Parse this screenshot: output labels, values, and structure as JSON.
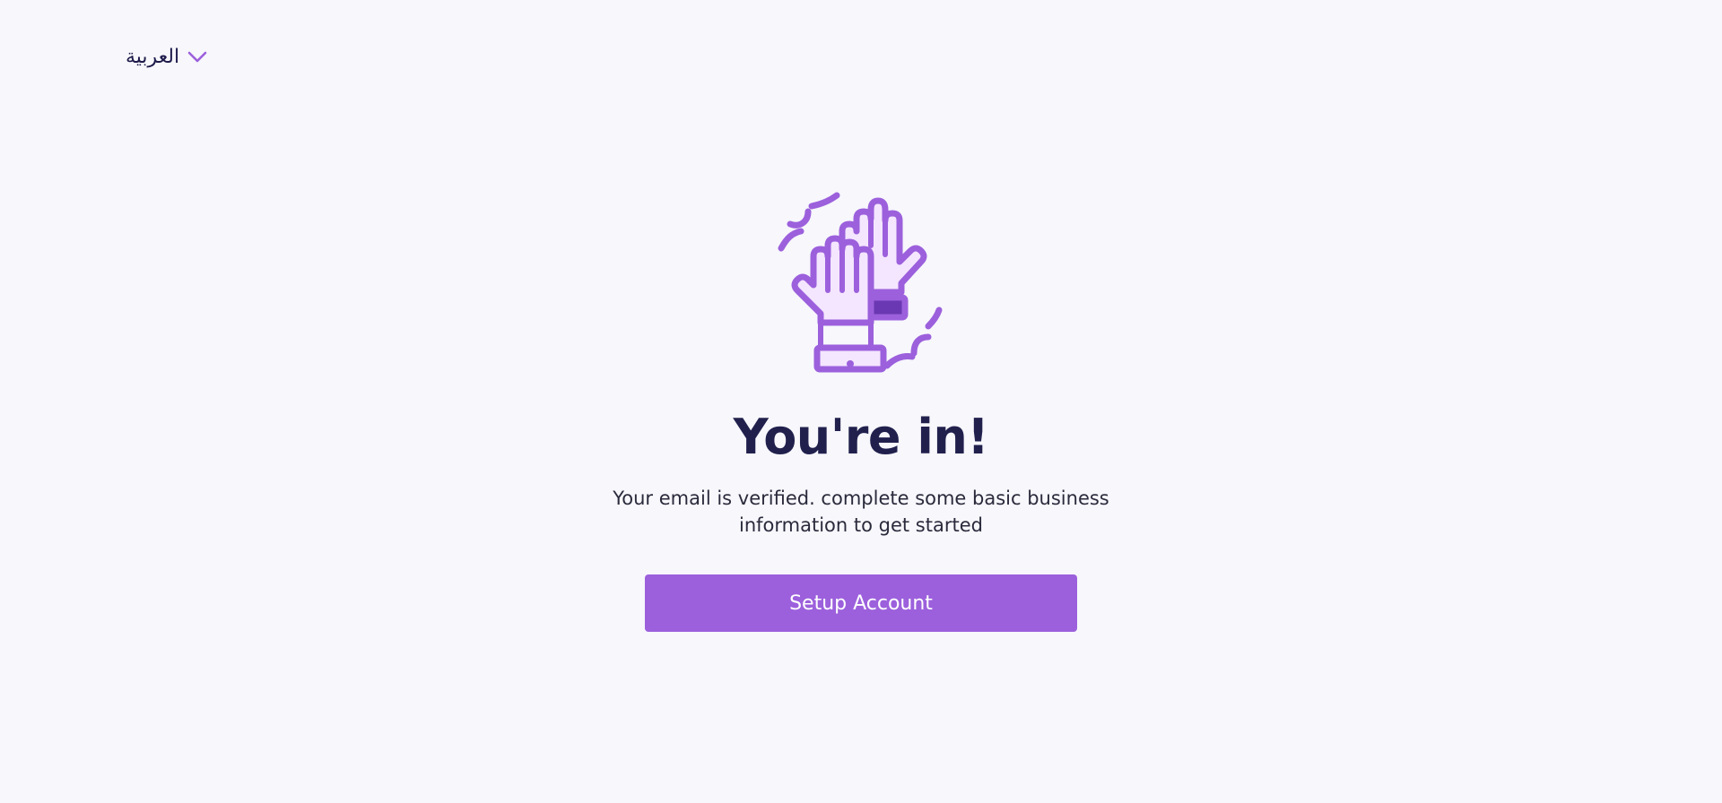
{
  "language_switcher": {
    "label": "العربية",
    "chevron_icon": "chevron-down-icon"
  },
  "hero": {
    "illustration_icon": "high-five-hands-icon",
    "title": "You're in!",
    "subtitle": "Your email is verified. complete some basic business information to get started",
    "button_label": "Setup Account"
  },
  "colors": {
    "background": "#f7f7fc",
    "accent": "#9c60dc",
    "accent_dark": "#6a38b2",
    "accent_light": "#f4e6ff",
    "title": "#21204d"
  }
}
